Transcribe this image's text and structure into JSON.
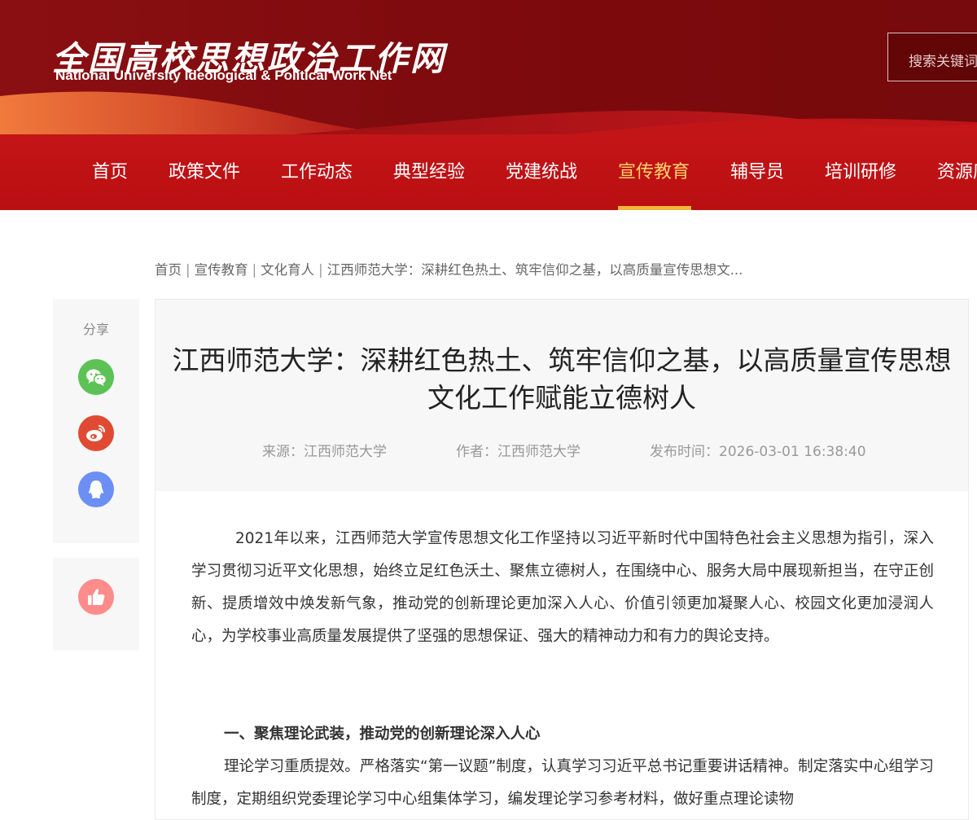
{
  "header": {
    "logo_cn": "全国高校思想政治工作网",
    "logo_en": "National University Ideological & Political Work Net",
    "search_placeholder": "搜索关键词"
  },
  "nav": {
    "items": [
      {
        "label": "首页"
      },
      {
        "label": "政策文件"
      },
      {
        "label": "工作动态"
      },
      {
        "label": "典型经验"
      },
      {
        "label": "党建统战"
      },
      {
        "label": "宣传教育",
        "active": true
      },
      {
        "label": "辅导员"
      },
      {
        "label": "培训研修"
      },
      {
        "label": "资源库"
      }
    ]
  },
  "breadcrumb": {
    "items": [
      "首页",
      "宣传教育",
      "文化育人",
      "江西师范大学：深耕红色热土、筑牢信仰之基，以高质量宣传思想文..."
    ],
    "separator": "|"
  },
  "share": {
    "title": "分享",
    "buttons": [
      {
        "name": "wechat",
        "icon": "wechat-icon",
        "color": "#5cc255"
      },
      {
        "name": "weibo",
        "icon": "weibo-icon",
        "color": "#e04a33"
      },
      {
        "name": "qq",
        "icon": "qq-icon",
        "color": "#6b8ff5"
      }
    ],
    "like": {
      "icon": "thumbs-up-icon",
      "color": "#ff8b8b"
    }
  },
  "article": {
    "title": "江西师范大学：深耕红色热土、筑牢信仰之基，以高质量宣传思想文化工作赋能立德树人",
    "source": "来源：江西师范大学",
    "author": "作者：江西师范大学",
    "published": "发布时间：2026-03-01 16:38:40",
    "paragraph1": "2021年以来，江西师范大学宣传思想文化工作坚持以习近平新时代中国特色社会主义思想为指引，深入学习贯彻习近平文化思想，始终立足红色沃土、聚焦立德树人，在围绕中心、服务大局中展现新担当，在守正创新、提质增效中焕发新气象，推动党的创新理论更加深入人心、价值引领更加凝聚人心、校园文化更加浸润人心，为学校事业高质量发展提供了坚强的思想保证、强大的精神动力和有力的舆论支持。",
    "heading1": "一、聚焦理论武装，推动党的创新理论深入人心",
    "paragraph2": "理论学习重质提效。严格落实“第一议题”制度，认真学习习近平总书记重要讲话精神。制定落实中心组学习制度，定期组织党委理论学习中心组集体学习，编发理论学习参考材料，做好重点理论读物"
  },
  "colors": {
    "header_bg": "#7d0a0d",
    "nav_bg": "#c41417",
    "nav_active": "#ffd26a",
    "nav_underline": "#f2b63a"
  }
}
